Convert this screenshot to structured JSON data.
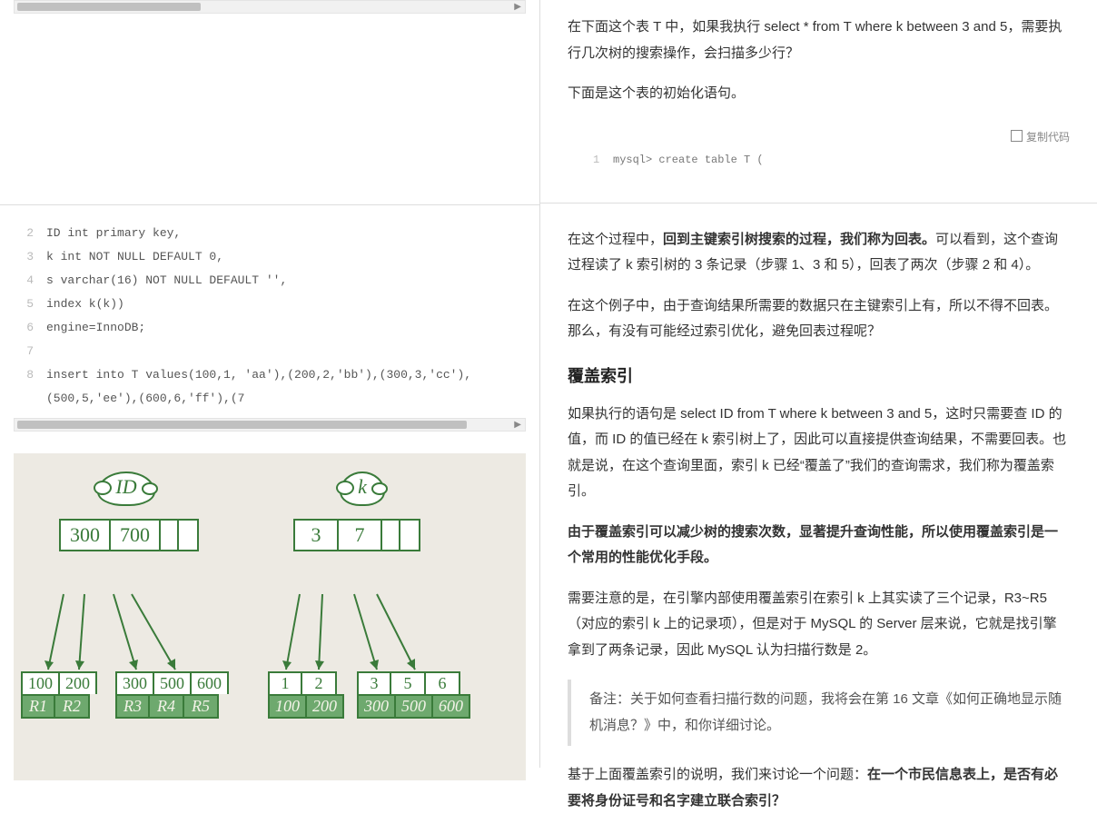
{
  "right": {
    "p1": "在下面这个表 T 中，如果我执行 select * from T where k between 3 and 5，需要执行几次树的搜索操作，会扫描多少行？",
    "p2": "下面是这个表的初始化语句。",
    "copy_label": "复制代码",
    "code_ln": "1",
    "code_txt": "mysql> create table T (",
    "p3a": "在这个过程中，",
    "p3b": "回到主键索引树搜索的过程，我们称为回表。",
    "p3c": "可以看到，这个查询过程读了 k 索引树的 3 条记录（步骤 1、3 和 5），回表了两次（步骤 2 和 4）。",
    "p4": "在这个例子中，由于查询结果所需要的数据只在主键索引上有，所以不得不回表。那么，有没有可能经过索引优化，避免回表过程呢？",
    "h_cover": "覆盖索引",
    "p5": "如果执行的语句是 select ID from T where k between 3 and 5，这时只需要查 ID 的值，而 ID 的值已经在 k 索引树上了，因此可以直接提供查询结果，不需要回表。也就是说，在这个查询里面，索引 k 已经“覆盖了”我们的查询需求，我们称为覆盖索引。",
    "p6": "由于覆盖索引可以减少树的搜索次数，显著提升查询性能，所以使用覆盖索引是一个常用的性能优化手段。",
    "p7": "需要注意的是，在引擎内部使用覆盖索引在索引 k 上其实读了三个记录，R3~R5（对应的索引 k 上的记录项），但是对于 MySQL 的 Server 层来说，它就是找引擎拿到了两条记录，因此 MySQL 认为扫描行数是 2。",
    "bq": "备注：关于如何查看扫描行数的问题，我将会在第 16 文章《如何正确地显示随机消息？》中，和你详细讨论。",
    "p8a": "基于上面覆盖索引的说明，我们来讨论一个问题：",
    "p8b": "在一个市民信息表上，是否有必要将身份证号和名字建立联合索引？"
  },
  "code": {
    "lines": [
      {
        "n": "2",
        "t": "ID int primary key,"
      },
      {
        "n": "3",
        "t": "k int NOT NULL DEFAULT 0,"
      },
      {
        "n": "4",
        "t": "s varchar(16) NOT NULL DEFAULT '',"
      },
      {
        "n": "5",
        "t": "index k(k))"
      },
      {
        "n": "6",
        "t": "engine=InnoDB;"
      },
      {
        "n": "7",
        "t": ""
      },
      {
        "n": "8",
        "t": "insert into T values(100,1, 'aa'),(200,2,'bb'),(300,3,'cc'),(500,5,'ee'),(600,6,'ff'),(7"
      }
    ]
  },
  "diagram": {
    "left_tree": {
      "label": "ID",
      "root": [
        "300",
        "700"
      ],
      "leaves": [
        {
          "keys": [
            "100",
            "200"
          ],
          "vals": [
            "R1",
            "R2"
          ]
        },
        {
          "keys": [
            "300",
            "500",
            "600"
          ],
          "vals": [
            "R3",
            "R4",
            "R5"
          ]
        }
      ]
    },
    "right_tree": {
      "label": "k",
      "root": [
        "3",
        "7"
      ],
      "leaves": [
        {
          "keys": [
            "1",
            "2"
          ],
          "vals": [
            "100",
            "200"
          ]
        },
        {
          "keys": [
            "3",
            "5",
            "6"
          ],
          "vals": [
            "300",
            "500",
            "600"
          ]
        }
      ]
    }
  }
}
